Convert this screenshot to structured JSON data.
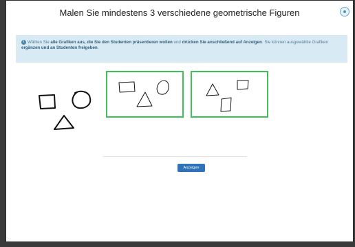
{
  "header": {
    "title": "Malen Sie mindestens 3 verschiedene geometrische Figuren"
  },
  "info": {
    "icon": "info-icon",
    "t1": "Wählen Sie ",
    "b1": "alle Grafiken aus, die Sie den Studenten präsentieren wollen",
    "t2": " und ",
    "b2": "drücken Sie anschließend auf Anzeigen",
    "t3": ". Sie können ausgewählte Grafiken ",
    "b3": "ergänzen und an Studenten freigeben",
    "t4": "."
  },
  "actions": {
    "show_label": "Anzeigen"
  },
  "colors": {
    "selected_border": "#3fbf55",
    "info_background": "#d8eaf4",
    "button": "#2e73b8"
  }
}
